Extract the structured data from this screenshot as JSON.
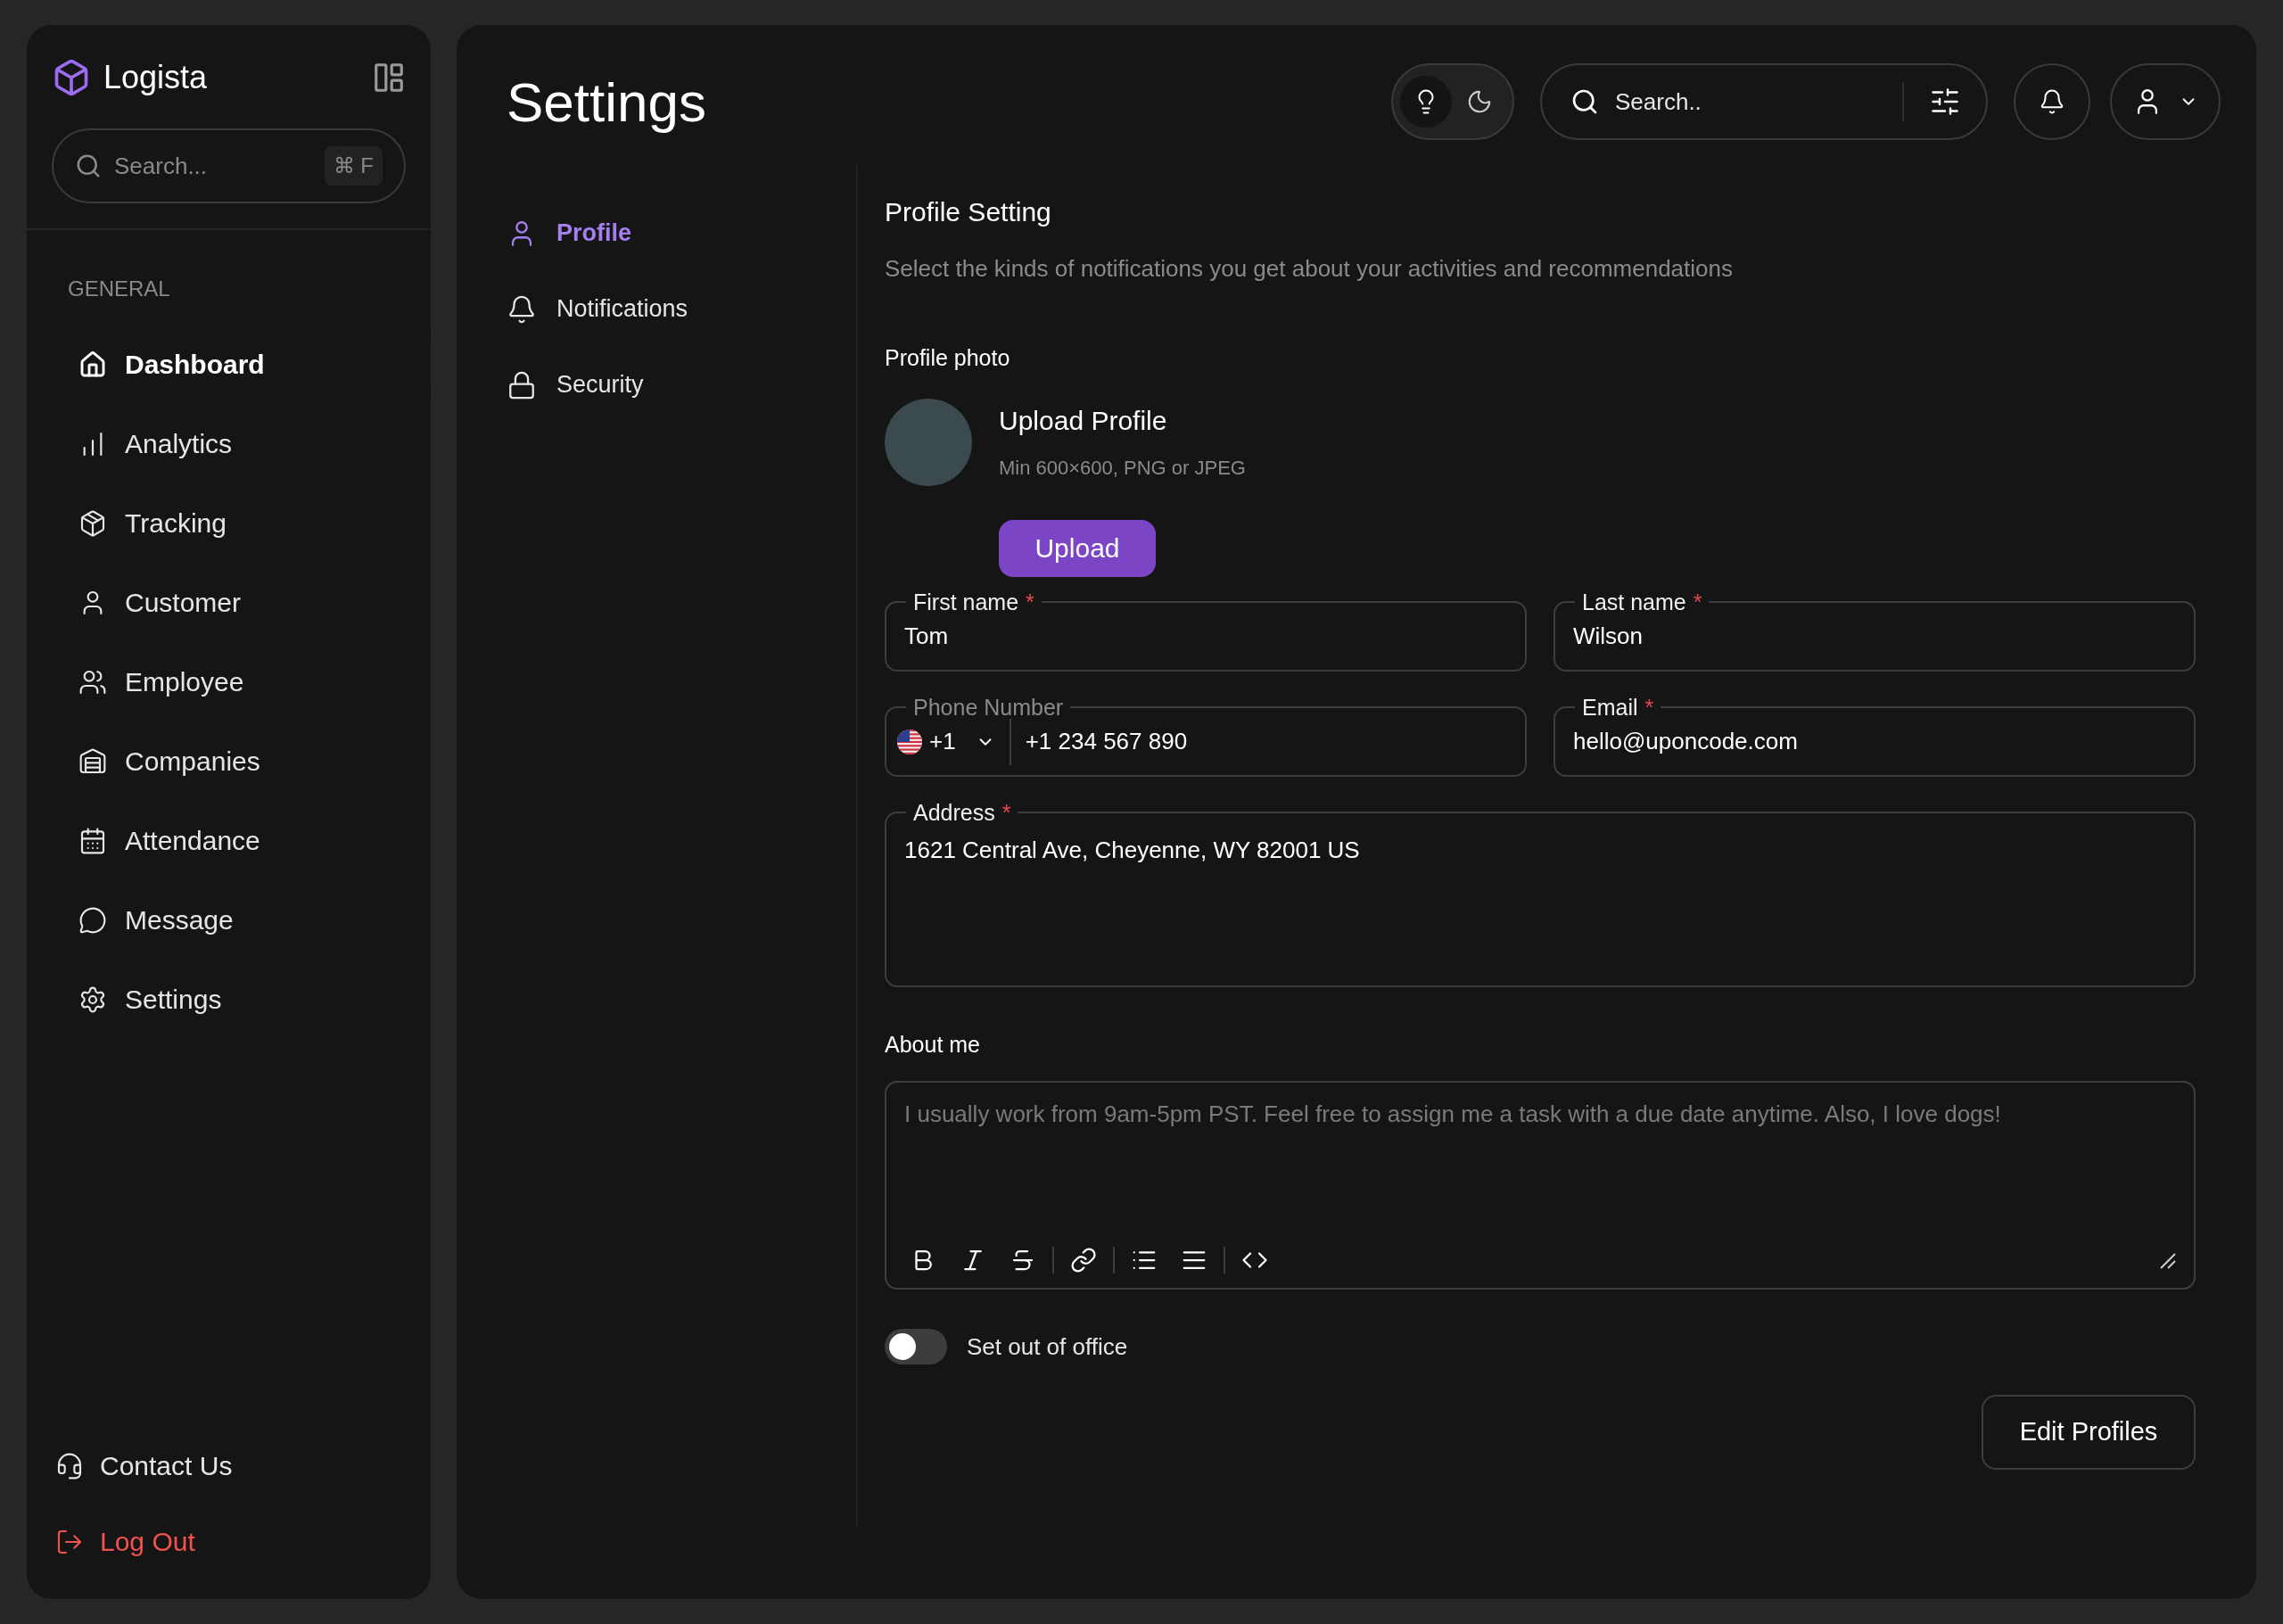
{
  "sidebar": {
    "brand": "Logista",
    "search": {
      "placeholder": "Search...",
      "shortcut": "⌘ F"
    },
    "section_label": "GENERAL",
    "items": [
      {
        "label": "Dashboard",
        "selected": true
      },
      {
        "label": "Analytics",
        "selected": false
      },
      {
        "label": "Tracking",
        "selected": false
      },
      {
        "label": "Customer",
        "selected": false
      },
      {
        "label": "Employee",
        "selected": false
      },
      {
        "label": "Companies",
        "selected": false
      },
      {
        "label": "Attendance",
        "selected": false
      },
      {
        "label": "Message",
        "selected": false
      },
      {
        "label": "Settings",
        "selected": false
      }
    ],
    "footer": [
      {
        "label": "Contact Us",
        "kind": "normal"
      },
      {
        "label": "Log Out",
        "kind": "danger"
      }
    ]
  },
  "header": {
    "title": "Settings",
    "theme": [
      {
        "selected": true
      },
      {
        "selected": false
      }
    ],
    "search": {
      "placeholder": "Search.."
    }
  },
  "settings_nav": [
    {
      "label": "Profile",
      "selected": true
    },
    {
      "label": "Notifications",
      "selected": false
    },
    {
      "label": "Security",
      "selected": false
    }
  ],
  "profile": {
    "title": "Profile Setting",
    "description": "Select the kinds of notifications you get about your activities and recommendations",
    "photo_label": "Profile photo",
    "upload_title": "Upload Profile",
    "upload_hint": "Min 600×600, PNG or JPEG",
    "upload_button": "Upload",
    "fields": [
      {
        "kind": "text",
        "label": "First name",
        "required_mark": "*",
        "value": "Tom"
      },
      {
        "kind": "text",
        "label": "Last name",
        "required_mark": "*",
        "value": "Wilson"
      },
      {
        "kind": "phone",
        "label": "Phone Number",
        "country_code": "+1",
        "value": "+1 234 567 890"
      },
      {
        "kind": "text",
        "label": "Email",
        "required_mark": "*",
        "value": "hello@uponcode.com"
      },
      {
        "kind": "area",
        "label": "Address",
        "required_mark": "*",
        "value": "1621 Central Ave, Cheyenne, WY 82001 US"
      }
    ],
    "about": {
      "label": "About me",
      "placeholder": "I usually work from 9am-5pm PST. Feel free to assign me a task with a due date anytime. Also, I love dogs!"
    },
    "out_of_office": {
      "label": "Set out of office",
      "on": false
    },
    "save_button": "Edit Profiles"
  }
}
